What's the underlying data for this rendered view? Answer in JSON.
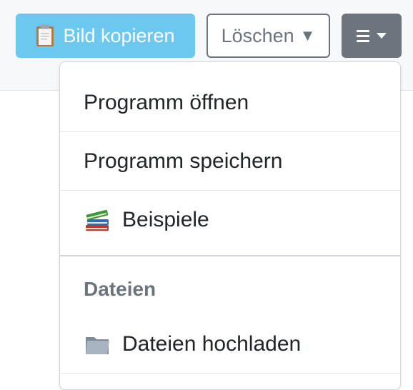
{
  "toolbar": {
    "copy_button": {
      "label": "Bild kopieren",
      "icon": "clipboard-icon"
    },
    "delete_button": {
      "label": "Löschen",
      "arrow": "▼"
    },
    "menu_button": {
      "icon": "hamburger-menu-icon"
    }
  },
  "dropdown": {
    "items": [
      {
        "label": "Programm öffnen"
      },
      {
        "label": "Programm speichern"
      },
      {
        "label": "Beispiele",
        "icon": "books-icon"
      }
    ],
    "section": {
      "header": "Dateien",
      "items": [
        {
          "label": "Dateien hochladen",
          "icon": "folder-icon"
        }
      ]
    }
  },
  "colors": {
    "copy_button_bg": "#6cc8ee",
    "secondary": "#6c757d",
    "toolbar_bg": "#f7f8fa",
    "text": "#212529"
  }
}
